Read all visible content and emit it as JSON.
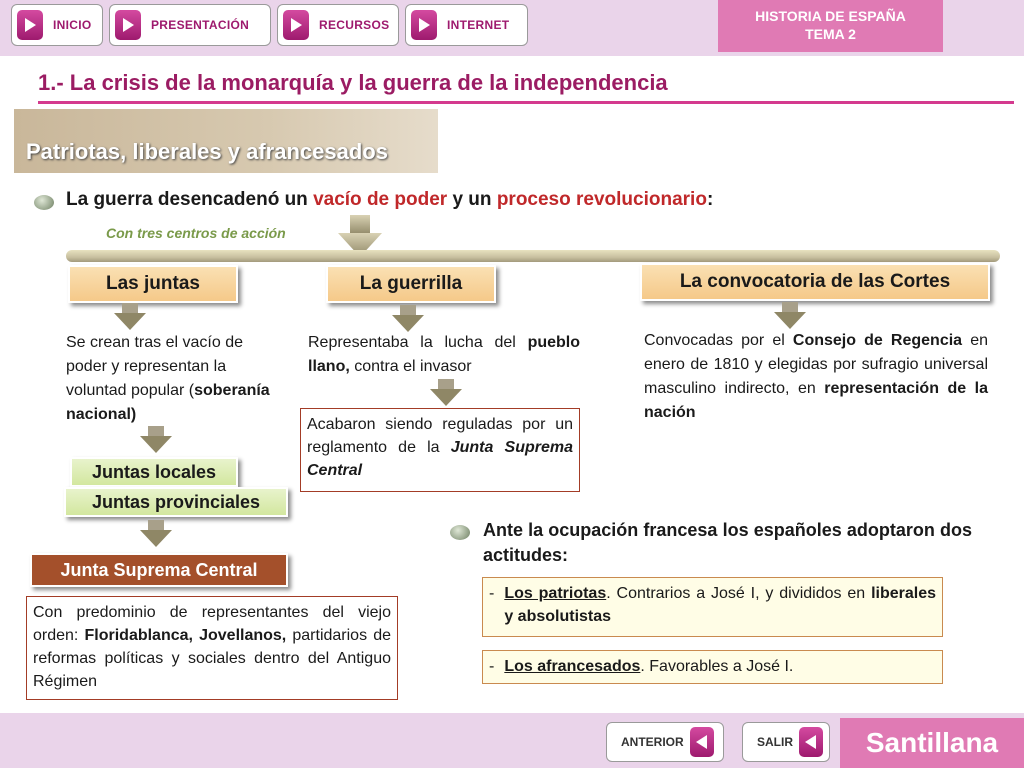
{
  "nav": {
    "items": [
      {
        "label": "INICIO"
      },
      {
        "label": "PRESENTACIÓN"
      },
      {
        "label": "RECURSOS"
      },
      {
        "label": "INTERNET"
      }
    ],
    "brand_line1": "HISTORIA DE ESPAÑA",
    "brand_line2": "TEMA 2"
  },
  "title": "1.- La crisis de la monarquía y la guerra de la independencia",
  "section": "Patriotas, liberales y afrancesados",
  "intro": {
    "pre": "La guerra desencadenó un ",
    "hl1": "vacío de poder",
    "mid": " y un ",
    "hl2": "proceso revolucionario",
    "post": ":"
  },
  "subnote": "Con tres centros de acción",
  "columns": {
    "juntas": {
      "label": "Las juntas",
      "text1": "Se crean tras el vacío de poder y representan la voluntad popular (",
      "text_bold": "soberanía nacional)",
      "locales": "Juntas locales",
      "provinciales": "Juntas provinciales",
      "central": "Junta Suprema Central",
      "central_pre": "Con predominio de representantes del viejo orden: ",
      "central_bold": "Floridablanca, Jovellanos,",
      "central_post": " partidarios de reformas políticas y sociales dentro del Antiguo Régimen"
    },
    "guerrilla": {
      "label": "La guerrilla",
      "text_pre": "Representaba la lucha del ",
      "text_bold": "pueblo llano,",
      "text_post": " contra el invasor",
      "box_pre": "Acabaron siendo reguladas por un reglamento de la ",
      "box_bold": "Junta Suprema Central"
    },
    "cortes": {
      "label": "La convocatoria de las Cortes",
      "t1": "Convocadas por el ",
      "b1": "Consejo de Regencia",
      "t2": " en enero de 1810 y elegidas por sufragio universal masculino indirecto, en ",
      "b2": "representación de la nación"
    }
  },
  "actitudes": {
    "intro": "Ante la ocupación francesa los españoles adoptaron dos actitudes:",
    "patriotas_dash": "-",
    "patriotas_label": "Los patriotas",
    "patriotas_text": ". Contrarios a José I, y divididos en ",
    "patriotas_bold": "liberales y absolutistas",
    "afr_dash": "-",
    "afr_label": "Los afrancesados",
    "afr_text": ". Favorables a José I."
  },
  "footer": {
    "anterior": "ANTERIOR",
    "salir": "SALIR",
    "brand": "Santillana"
  }
}
